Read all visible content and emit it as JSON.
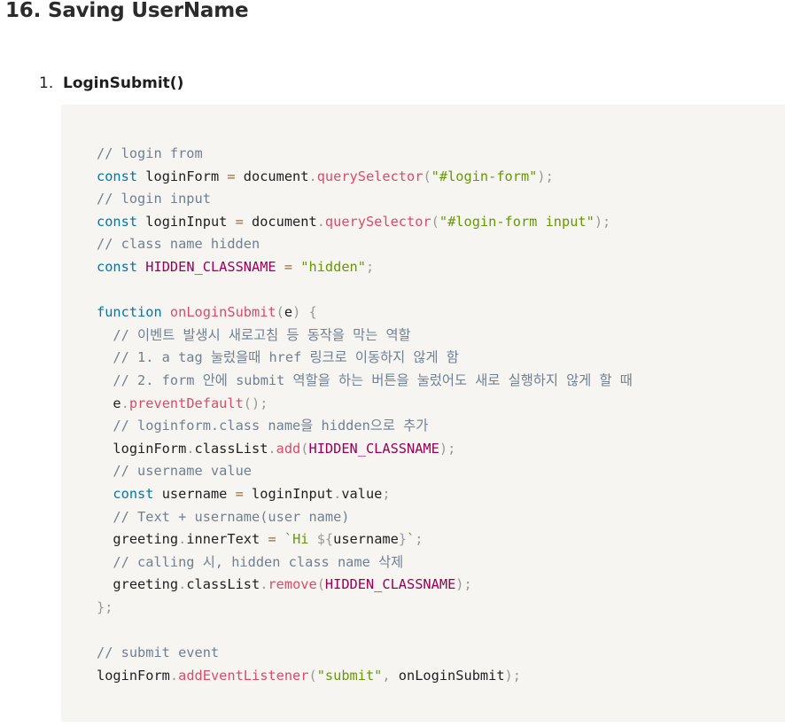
{
  "heading": "16. Saving UserName",
  "list": {
    "number": "1.",
    "title": "LoginSubmit()"
  },
  "code": {
    "lines": [
      [
        [
          "c",
          "// login from"
        ]
      ],
      [
        [
          "k",
          "const"
        ],
        [
          "t",
          " loginForm "
        ],
        [
          "o",
          "="
        ],
        [
          "t",
          " document"
        ],
        [
          "p",
          "."
        ],
        [
          "f",
          "querySelector"
        ],
        [
          "p",
          "("
        ],
        [
          "s",
          "\"#login-form\""
        ],
        [
          "p",
          ");"
        ]
      ],
      [
        [
          "c",
          "// login input"
        ]
      ],
      [
        [
          "k",
          "const"
        ],
        [
          "t",
          " loginInput "
        ],
        [
          "o",
          "="
        ],
        [
          "t",
          " document"
        ],
        [
          "p",
          "."
        ],
        [
          "f",
          "querySelector"
        ],
        [
          "p",
          "("
        ],
        [
          "s",
          "\"#login-form input\""
        ],
        [
          "p",
          ");"
        ]
      ],
      [
        [
          "c",
          "// class name hidden"
        ]
      ],
      [
        [
          "k",
          "const"
        ],
        [
          "t",
          " "
        ],
        [
          "v",
          "HIDDEN_CLASSNAME"
        ],
        [
          "t",
          " "
        ],
        [
          "o",
          "="
        ],
        [
          "t",
          " "
        ],
        [
          "s",
          "\"hidden\""
        ],
        [
          "p",
          ";"
        ]
      ],
      [],
      [
        [
          "k",
          "function"
        ],
        [
          "t",
          " "
        ],
        [
          "f",
          "onLoginSubmit"
        ],
        [
          "p",
          "("
        ],
        [
          "t",
          "e"
        ],
        [
          "p",
          ")"
        ],
        [
          "t",
          " "
        ],
        [
          "p",
          "{"
        ]
      ],
      [
        [
          "t",
          "  "
        ],
        [
          "c",
          "// 이벤트 발생시 새로고침 등 동작을 막는 역할"
        ]
      ],
      [
        [
          "t",
          "  "
        ],
        [
          "c",
          "// 1. a tag 눌렀을때 href 링크로 이동하지 않게 함"
        ]
      ],
      [
        [
          "t",
          "  "
        ],
        [
          "c",
          "// 2. form 안에 submit 역할을 하는 버튼을 눌렀어도 새로 실행하지 않게 할 때"
        ]
      ],
      [
        [
          "t",
          "  e"
        ],
        [
          "p",
          "."
        ],
        [
          "f",
          "preventDefault"
        ],
        [
          "p",
          "();"
        ]
      ],
      [
        [
          "t",
          "  "
        ],
        [
          "c",
          "// loginform.class name을 hidden으로 추가"
        ]
      ],
      [
        [
          "t",
          "  loginForm"
        ],
        [
          "p",
          "."
        ],
        [
          "t",
          "classList"
        ],
        [
          "p",
          "."
        ],
        [
          "f",
          "add"
        ],
        [
          "p",
          "("
        ],
        [
          "v",
          "HIDDEN_CLASSNAME"
        ],
        [
          "p",
          ");"
        ]
      ],
      [
        [
          "t",
          "  "
        ],
        [
          "c",
          "// username value"
        ]
      ],
      [
        [
          "t",
          "  "
        ],
        [
          "k",
          "const"
        ],
        [
          "t",
          " username "
        ],
        [
          "o",
          "="
        ],
        [
          "t",
          " loginInput"
        ],
        [
          "p",
          "."
        ],
        [
          "t",
          "value"
        ],
        [
          "p",
          ";"
        ]
      ],
      [
        [
          "t",
          "  "
        ],
        [
          "c",
          "// Text + username(user name)"
        ]
      ],
      [
        [
          "t",
          "  greeting"
        ],
        [
          "p",
          "."
        ],
        [
          "t",
          "innerText "
        ],
        [
          "o",
          "="
        ],
        [
          "t",
          " "
        ],
        [
          "s",
          "`Hi "
        ],
        [
          "p",
          "${"
        ],
        [
          "t",
          "username"
        ],
        [
          "p",
          "}"
        ],
        [
          "s",
          "`"
        ],
        [
          "p",
          ";"
        ]
      ],
      [
        [
          "t",
          "  "
        ],
        [
          "c",
          "// calling 시, hidden class name 삭제"
        ]
      ],
      [
        [
          "t",
          "  greeting"
        ],
        [
          "p",
          "."
        ],
        [
          "t",
          "classList"
        ],
        [
          "p",
          "."
        ],
        [
          "f",
          "remove"
        ],
        [
          "p",
          "("
        ],
        [
          "v",
          "HIDDEN_CLASSNAME"
        ],
        [
          "p",
          ");"
        ]
      ],
      [
        [
          "p",
          "};"
        ]
      ],
      [],
      [
        [
          "c",
          "// submit event"
        ]
      ],
      [
        [
          "t",
          "loginForm"
        ],
        [
          "p",
          "."
        ],
        [
          "f",
          "addEventListener"
        ],
        [
          "p",
          "("
        ],
        [
          "s",
          "\"submit\""
        ],
        [
          "p",
          ","
        ],
        [
          "t",
          " onLoginSubmit"
        ],
        [
          "p",
          ");"
        ]
      ]
    ]
  }
}
